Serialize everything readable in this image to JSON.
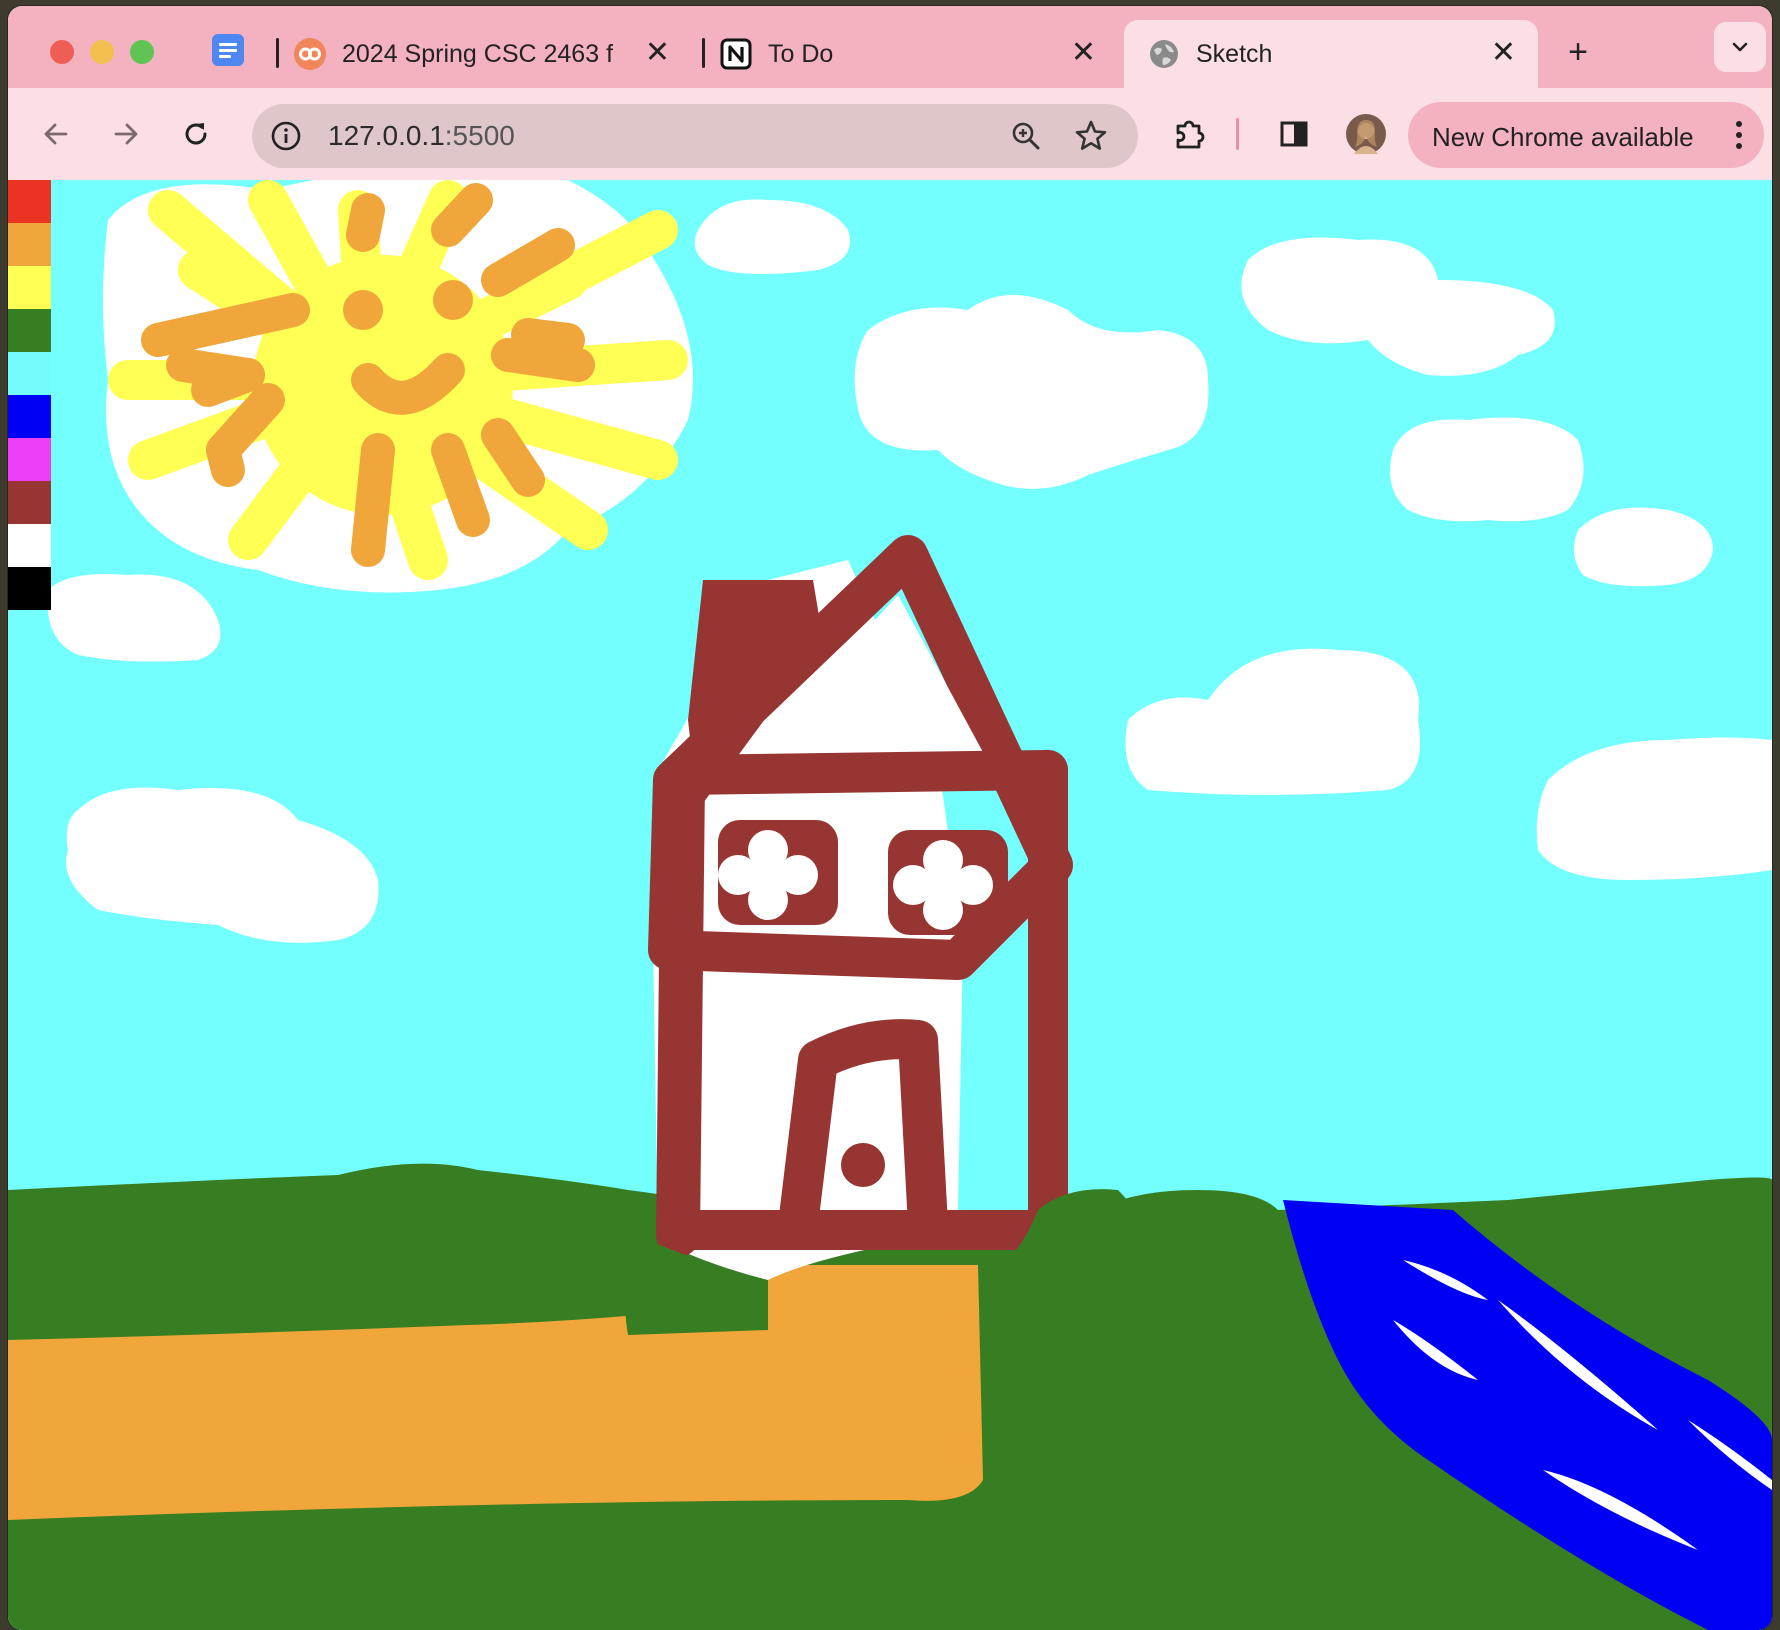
{
  "browser": {
    "tabs": [
      {
        "title": "2024 Spring CSC 2463 f",
        "close": "✕",
        "favicon": "orange-link-icon",
        "active": false
      },
      {
        "title": "To Do",
        "close": "✕",
        "favicon": "notion-icon",
        "active": false
      },
      {
        "title": "Sketch",
        "close": "✕",
        "favicon": "globe-icon",
        "active": true
      }
    ],
    "pinned_tab_icon": "google-docs-icon",
    "new_tab_label": "+",
    "address": {
      "host": "127.0.0.1",
      "port": ":5500"
    },
    "update_chip": "New Chrome available",
    "colors": {
      "tabstrip": "#f4b2c1",
      "toolbar": "#fbdfe4",
      "omnibox": "#dec6c9"
    }
  },
  "sketch": {
    "palette": [
      {
        "name": "red",
        "color": "#ea3323"
      },
      {
        "name": "orange",
        "color": "#f0a63a"
      },
      {
        "name": "yellow",
        "color": "#ffff54"
      },
      {
        "name": "green",
        "color": "#377e22"
      },
      {
        "name": "cyan",
        "color": "#74fbfd"
      },
      {
        "name": "blue",
        "color": "#0000f5"
      },
      {
        "name": "magenta",
        "color": "#ea3ff7"
      },
      {
        "name": "brown",
        "color": "#973532"
      },
      {
        "name": "white",
        "color": "#ffffff"
      },
      {
        "name": "black",
        "color": "#000000"
      }
    ],
    "canvas_colors": {
      "sky": "#74ffff",
      "cloud": "#ffffff",
      "sun_yellow": "#ffff54",
      "sun_orange": "#f0a63a",
      "grass": "#377e22",
      "house": "#973532",
      "path": "#f0a63a",
      "river": "#0000f5"
    }
  }
}
